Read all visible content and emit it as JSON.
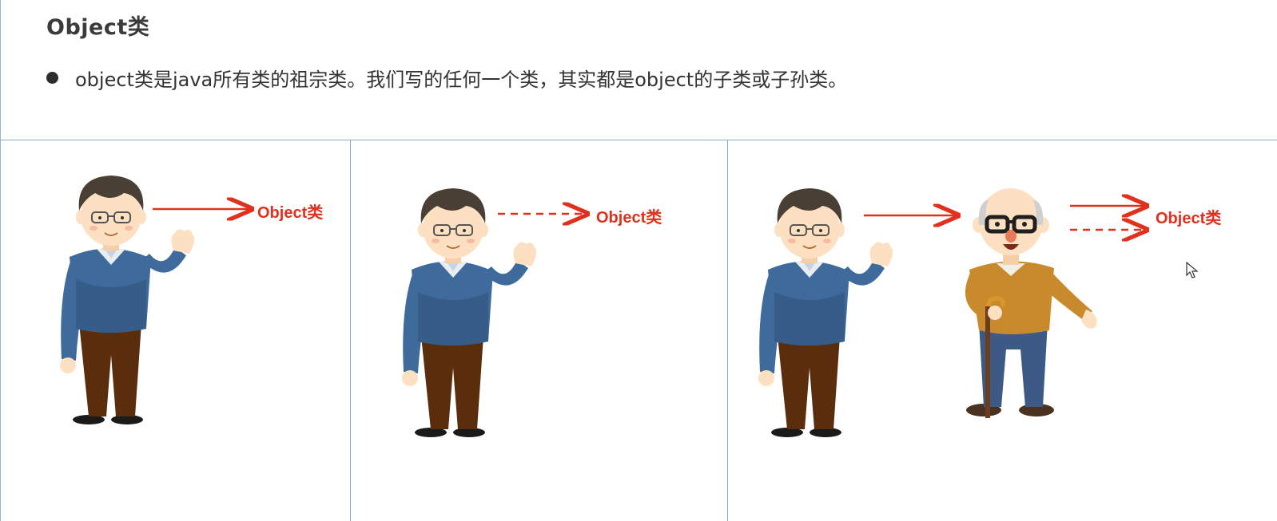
{
  "title": "Object类",
  "bullet": "object类是java所有类的祖宗类。我们写的任何一个类，其实都是object的子类或子孙类。",
  "panels": [
    {
      "label": "Object类",
      "arrow": "solid"
    },
    {
      "label": "Object类",
      "arrow": "dashed"
    },
    {
      "label": "Object类",
      "arrows": [
        "solid",
        "dashed"
      ]
    }
  ],
  "colors": {
    "arrow": "#e0301e",
    "divider": "#8ea8c8",
    "sweater": "#3f6b9c",
    "trousers": "#5a2d0c",
    "grandpa_sweater": "#c98a2e",
    "grandpa_trousers": "#3d5a86"
  }
}
